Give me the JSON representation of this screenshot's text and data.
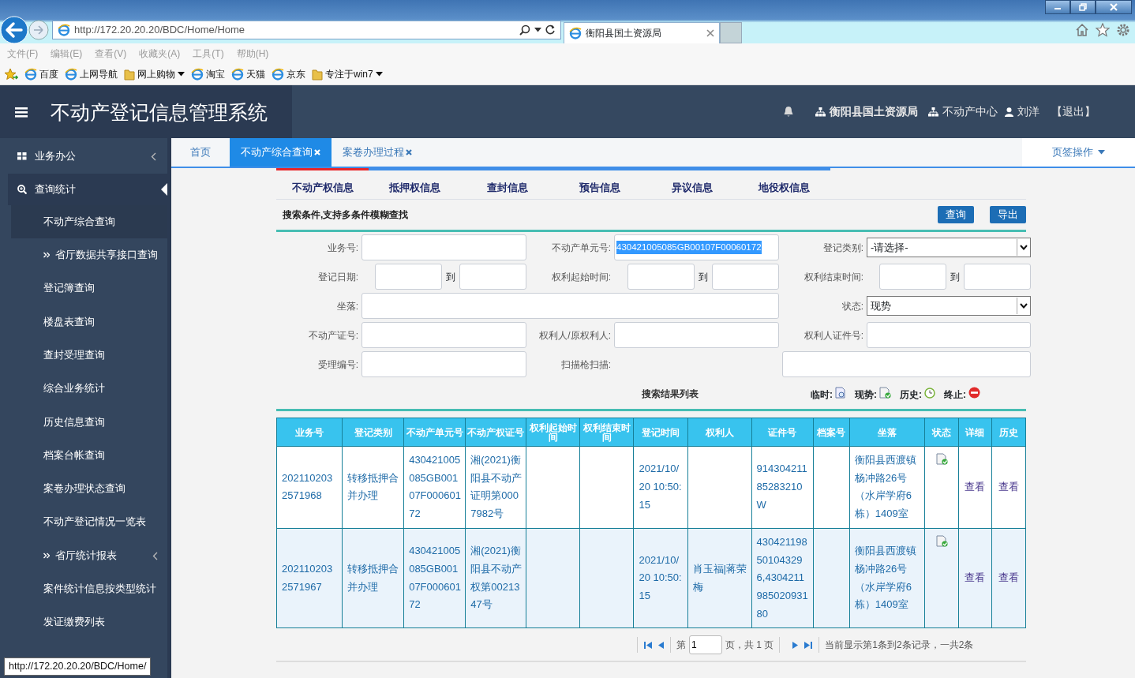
{
  "browser": {
    "address": "http://172.20.20.20/BDC/Home/Home",
    "tabs": [
      {
        "title": "衡阳县国土资源局",
        "selected": true
      }
    ],
    "menu": [
      "文件(F)",
      "编辑(E)",
      "查看(V)",
      "收藏夹(A)",
      "工具(T)",
      "帮助(H)"
    ],
    "favorites": [
      {
        "label": "百度",
        "kind": "page"
      },
      {
        "label": "上网导航",
        "kind": "page"
      },
      {
        "label": "网上购物",
        "kind": "folder",
        "dropdown": true
      },
      {
        "label": "淘宝",
        "kind": "page"
      },
      {
        "label": "天猫",
        "kind": "page"
      },
      {
        "label": "京东",
        "kind": "page"
      },
      {
        "label": "专注于win7",
        "kind": "folder",
        "dropdown": true
      }
    ],
    "status_text": "http://172.20.20.20/BDC/Home/"
  },
  "header": {
    "title": "不动产登记信息管理系统",
    "org": "衡阳县国土资源局",
    "dept": "不动产中心",
    "user": "刘洋",
    "logout": "【退出】"
  },
  "sidebar": {
    "groups": [
      {
        "label": "业务办公",
        "kind": "grid",
        "expanded": false
      },
      {
        "label": "查询统计",
        "kind": "search",
        "expanded": true,
        "children": [
          {
            "label": "不动产综合查询",
            "kind": "item",
            "selected": true
          },
          {
            "label": "省厅数据共享接口查询",
            "kind": "submenu",
            "selected": false
          },
          {
            "label": "登记簿查询",
            "kind": "item",
            "selected": false
          },
          {
            "label": "楼盘表查询",
            "kind": "item",
            "selected": false
          },
          {
            "label": "查封受理查询",
            "kind": "item",
            "selected": false
          },
          {
            "label": "综合业务统计",
            "kind": "item",
            "selected": false
          },
          {
            "label": "历史信息查询",
            "kind": "item",
            "selected": false
          },
          {
            "label": "档案台帐查询",
            "kind": "item",
            "selected": false
          },
          {
            "label": "案卷办理状态查询",
            "kind": "item",
            "selected": false
          },
          {
            "label": "不动产登记情况一览表",
            "kind": "item",
            "selected": false
          },
          {
            "label": "省厅统计报表",
            "kind": "submenu",
            "selected": false,
            "expandable": true
          },
          {
            "label": "案件统计信息按类型统计",
            "kind": "item",
            "selected": false
          },
          {
            "label": "发证缴费列表",
            "kind": "item",
            "selected": false
          }
        ]
      }
    ]
  },
  "page_tabs": [
    {
      "label": "首页",
      "selected": false,
      "closable": false
    },
    {
      "label": "不动产综合查询",
      "selected": true,
      "closable": true
    },
    {
      "label": "案卷办理过程",
      "selected": false,
      "closable": true
    }
  ],
  "page_ops": "页签操作",
  "sub_tabs": [
    {
      "label": "不动产权信息",
      "selected": true
    },
    {
      "label": "抵押权信息",
      "selected": false
    },
    {
      "label": "查封信息",
      "selected": false
    },
    {
      "label": "预告信息",
      "selected": false
    },
    {
      "label": "异议信息",
      "selected": false
    },
    {
      "label": "地役权信息",
      "selected": false
    }
  ],
  "search": {
    "title": "搜索条件,支持多条件模糊查找",
    "buttons": [
      "查询",
      "导出"
    ],
    "fields": [
      {
        "label": "业务号:",
        "kind": "input"
      },
      {
        "label": "不动产单元号:",
        "kind": "input",
        "value": "430421005085GB00107F00060172",
        "highlighted": true
      },
      {
        "label": "登记类别:",
        "kind": "select",
        "value": "-请选择-"
      },
      {
        "label": "登记日期:",
        "kind": "range",
        "to": "到"
      },
      {
        "label": "权利起始时间:",
        "kind": "range",
        "to": "到"
      },
      {
        "label": "权利结束时间:",
        "kind": "range",
        "to": "到"
      },
      {
        "label": "坐落:",
        "kind": "wide"
      },
      {
        "label": "状态:",
        "kind": "select",
        "value": "现势"
      },
      {
        "label": "不动产证号:",
        "kind": "input"
      },
      {
        "label": "权利人/原权利人:",
        "kind": "input"
      },
      {
        "label": "权利人证件号:",
        "kind": "input"
      },
      {
        "label": "受理编号:",
        "kind": "input"
      },
      {
        "label": "扫描枪扫描:",
        "kind": "scan"
      }
    ]
  },
  "results": {
    "title": "搜索结果列表",
    "legend": [
      {
        "label": "临时:",
        "kind": "temporary"
      },
      {
        "label": "现势:",
        "kind": "current"
      },
      {
        "label": "历史:",
        "kind": "history"
      },
      {
        "label": "终止:",
        "kind": "terminated"
      }
    ],
    "columns": [
      "业务号",
      "登记类别",
      "不动产单元号",
      "不动产权证号",
      "权利起始时间",
      "权利结束时间",
      "登记时间",
      "权利人",
      "证件号",
      "档案号",
      "坐落",
      "状态",
      "详细",
      "历史"
    ],
    "rows": [
      {
        "cells": [
          "2021102032571968",
          "转移抵押合并办理",
          "430421005085GB00107F00060172",
          "湘(2021)衡阳县不动产证明第0007982号",
          "",
          "",
          "2021/10/20 10:50:15",
          "",
          "91430421185283210W",
          "",
          "衡阳县西渡镇杨冲路26号（水岸学府6栋）1409室"
        ],
        "kind": "current",
        "detail": "查看",
        "history": "查看"
      },
      {
        "cells": [
          "2021102032571967",
          "转移抵押合并办理",
          "430421005085GB00107F00060172",
          "湘(2021)衡阳县不动产权第0021347号",
          "",
          "",
          "2021/10/20 10:50:15",
          "肖玉福|蒋荣梅",
          "430421198501043296,430421198502093180",
          "",
          "衡阳县西渡镇杨冲路26号（水岸学府6栋）1409室"
        ],
        "kind": "current",
        "detail": "查看",
        "history": "查看"
      }
    ]
  },
  "pagination": {
    "page_label": "第",
    "page": "1",
    "total": "页，共 1 页",
    "summary": "当前显示第1条到2条记录，一共2条"
  }
}
